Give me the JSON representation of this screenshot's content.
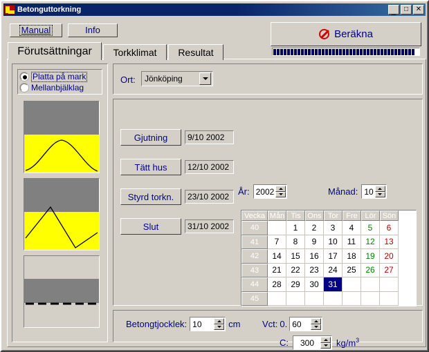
{
  "window": {
    "title": "Betonguttorkning",
    "icon": "app-icon",
    "minimize": "_",
    "maximize": "□",
    "close": "✕"
  },
  "toolbar": {
    "manual_label": "Manual",
    "info_label": "Info",
    "calculate_label": "Beräkna",
    "calculate_icon": "no-entry-icon",
    "progress_percent": 100,
    "progress_segments": 41
  },
  "tabs": [
    {
      "label": "Förutsättningar",
      "active": true
    },
    {
      "label": "Torkklimat",
      "active": false
    },
    {
      "label": "Resultat",
      "active": false
    }
  ],
  "construction": {
    "options": [
      {
        "label": "Platta på mark",
        "selected": true,
        "focused": true
      },
      {
        "label": "Mellanbjälklag",
        "selected": false,
        "focused": false
      }
    ],
    "figures": [
      {
        "name": "slab-on-ground-curve",
        "style": "arch"
      },
      {
        "name": "intermediate-slab-curve",
        "style": "zigzag"
      },
      {
        "name": "section-dashed",
        "style": "dashed"
      }
    ]
  },
  "location": {
    "label": "Ort:",
    "value": "Jönköping"
  },
  "period": {
    "year_label": "År:",
    "year_value": "2002",
    "month_label": "Månad:",
    "month_value": "10"
  },
  "milestones": [
    {
      "button": "Gjutning",
      "date": "9/10 2002"
    },
    {
      "button": "Tätt hus",
      "date": "12/10 2002"
    },
    {
      "button": "Styrd torkn.",
      "date": "23/10 2002"
    },
    {
      "button": "Slut",
      "date": "31/10 2002"
    }
  ],
  "calendar": {
    "headers": [
      "Vecka",
      "Mån",
      "Tis",
      "Ons",
      "Tor",
      "Fre",
      "Lör",
      "Sön"
    ],
    "selected_day": "31",
    "rows": [
      {
        "week": "40",
        "days": [
          "",
          "1",
          "2",
          "3",
          "4",
          "5",
          "6"
        ]
      },
      {
        "week": "41",
        "days": [
          "7",
          "8",
          "9",
          "10",
          "11",
          "12",
          "13"
        ]
      },
      {
        "week": "42",
        "days": [
          "14",
          "15",
          "16",
          "17",
          "18",
          "19",
          "20"
        ]
      },
      {
        "week": "43",
        "days": [
          "21",
          "22",
          "23",
          "24",
          "25",
          "26",
          "27"
        ]
      },
      {
        "week": "44",
        "days": [
          "28",
          "29",
          "30",
          "31",
          "",
          "",
          ""
        ]
      },
      {
        "week": "45",
        "days": [
          "",
          "",
          "",
          "",
          "",
          "",
          ""
        ]
      }
    ]
  },
  "parameters": {
    "thickness_label": "Betongtjocklek:",
    "thickness_value": "10",
    "thickness_unit": "cm",
    "vct_label": "Vct:",
    "vct_prefix": "0.",
    "vct_value": "60",
    "cement_label": "C:",
    "cement_value": "300",
    "cement_unit": "kg/m",
    "cement_unit_sup": "3"
  },
  "colors": {
    "face": "#d4d0c8",
    "titlebar": "#0a246a",
    "label_blue": "#00008b",
    "selection": "#000080",
    "saturday": "#008000",
    "sunday": "#c00000",
    "figure_yellow": "#ffff00",
    "figure_gray": "#808080",
    "calc_icon_red": "#d40000"
  }
}
